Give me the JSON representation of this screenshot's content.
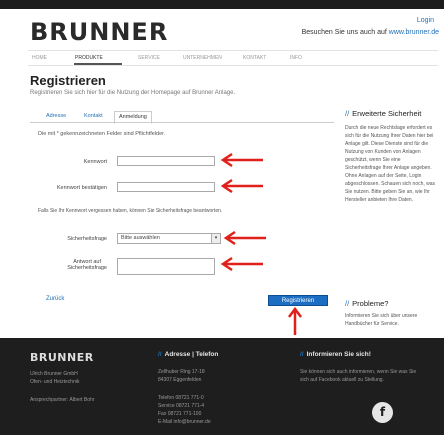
{
  "header": {
    "logo": "BRUNNER",
    "login": "Login",
    "visit_text": "Besuchen Sie uns auch auf",
    "visit_link": "www.brunner.de"
  },
  "nav": {
    "items": [
      "HOME",
      "PRODUKTE",
      "SERVICE",
      "UNTERNEHMEN",
      "KONTAKT",
      "INFO"
    ]
  },
  "page": {
    "title": "Registrieren",
    "subtitle": "Registrieren Sie sich hier für die Nutzung der Homepage auf Brunner Anlage."
  },
  "tabs": [
    "Adresse",
    "Kontakt",
    "Anmeldung"
  ],
  "form": {
    "required_note": "Die mit * gekennzeichneten Felder sind Pflichtfelder.",
    "password_label": "Kennwort",
    "password_confirm_label": "Kennwort bestätigen",
    "section_note": "Falls Sie Ihr Kennwort vergessen haben, können Sie Sicherheitsfrage beantworten.",
    "security_question_label": "Sicherheitsfrage",
    "security_question_selected": "Bitte auswählen",
    "answer_label_1": "Antwort auf",
    "answer_label_2": "Sicherheitsfrage",
    "back_label": "Zurück",
    "submit_label": "Registrieren"
  },
  "sidebar": {
    "security_title": "Erweiterte Sicherheit",
    "security_text": "Durch die neue Rechtslage erfordert es sich für die Nutzung Ihrer Daten hier bei Anlage gilt. Diese Dienste sind für die Nutzung von Kunden von Anlagen geschützt, wenn Sie eine Sicherheitsfrage Ihrer Anlage angeben. Ohne Anlagen auf der Seite, Login abgeschlossen. Schauen sich noch, was Sie nutzen. Bitte geben Sie an, wie Ihr Hersteller anbieten Ihre Daten.",
    "problems_title": "Probleme?",
    "problems_text": "Informieren Sie sich über unsere Handbücher für Service."
  },
  "footer": {
    "brand": "BRUNNER",
    "company_line1": "Ulrich Brunner GmbH",
    "company_line2": "Ofen- und Heiztechnik",
    "contact_person": "Ansprechpartner: Albert Bohr",
    "address_title": "Adresse | Telefon",
    "address_line1": "Zellhuber Ring 17-18",
    "address_line2": "84307 Eggenfelden",
    "phone_lines": [
      "Telefon 08721 771-0",
      "Service 08721 771-4",
      "Fax 08721 771-100",
      "E-Mail info@brunner.de"
    ],
    "info_title": "Informieren Sie sich!",
    "info_line1": "Sie können sich auch informieren, wenn Sie was Sie",
    "info_line2": "sich auf Facebook aktuell zu Stellung.",
    "facebook": "f"
  },
  "colors": {
    "accent": "#1b6ec2",
    "arrow": "#e0201b",
    "footer_bg": "#1e1e1e"
  }
}
